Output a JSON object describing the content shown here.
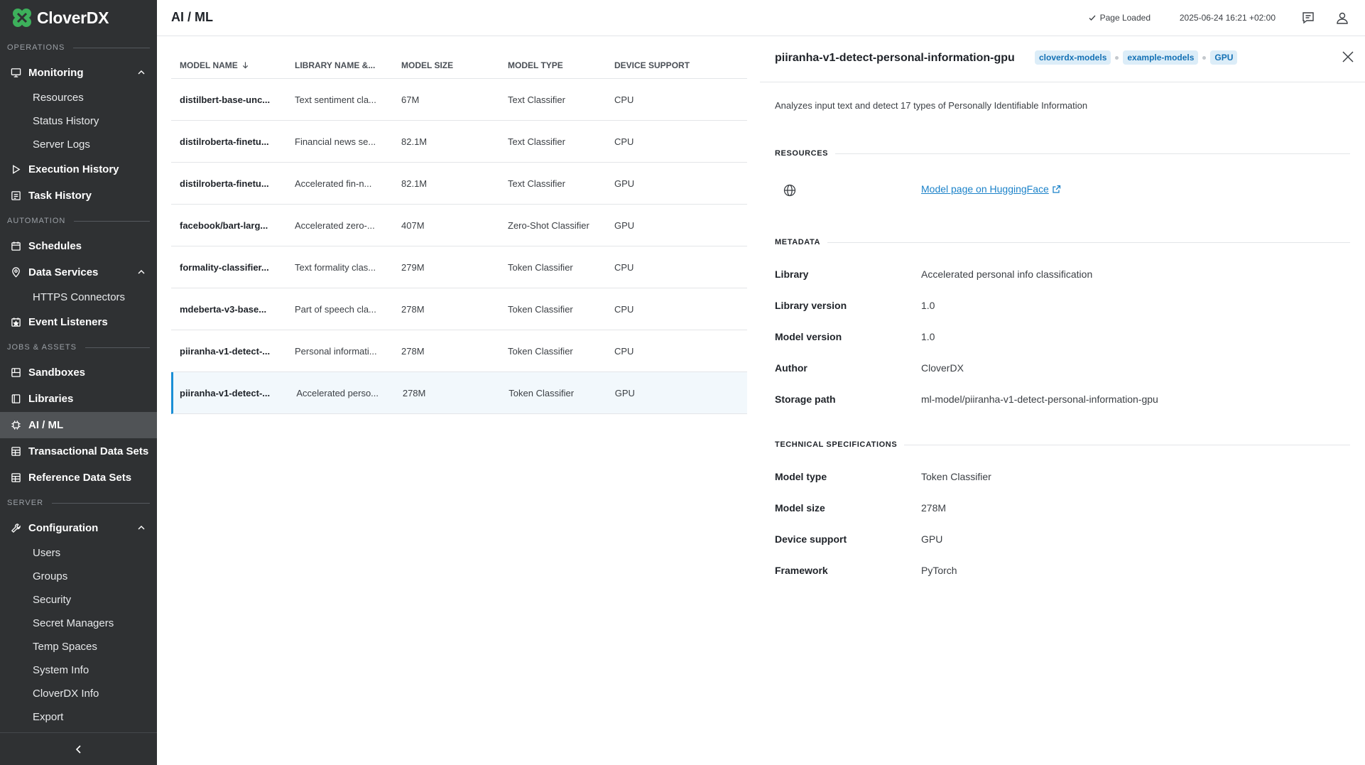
{
  "app": {
    "name": "CloverDX"
  },
  "sidebar": {
    "sections": {
      "operations": "OPERATIONS",
      "automation": "AUTOMATION",
      "jobs_assets": "JOBS & ASSETS",
      "server": "SERVER"
    },
    "monitoring": {
      "label": "Monitoring",
      "sub": [
        "Resources",
        "Status History",
        "Server Logs"
      ]
    },
    "execution_history": "Execution History",
    "task_history": "Task History",
    "schedules": "Schedules",
    "data_services": {
      "label": "Data Services",
      "sub": [
        "HTTPS Connectors"
      ]
    },
    "event_listeners": "Event Listeners",
    "sandboxes": "Sandboxes",
    "libraries": "Libraries",
    "ai_ml": "AI / ML",
    "transactional_data_sets": "Transactional Data Sets",
    "reference_data_sets": "Reference Data Sets",
    "configuration": {
      "label": "Configuration",
      "sub": [
        "Users",
        "Groups",
        "Security",
        "Secret Managers",
        "Temp Spaces",
        "System Info",
        "CloverDX Info",
        "Export"
      ]
    }
  },
  "header": {
    "title": "AI / ML",
    "status": "Page Loaded",
    "timestamp": "2025-06-24 16:21 +02:00"
  },
  "table": {
    "columns": [
      "MODEL NAME",
      "LIBRARY NAME &...",
      "MODEL SIZE",
      "MODEL TYPE",
      "DEVICE SUPPORT"
    ],
    "rows": [
      {
        "name": "distilbert-base-unc...",
        "library": "Text sentiment cla...",
        "size": "67M",
        "type": "Text Classifier",
        "device": "CPU"
      },
      {
        "name": "distilroberta-finetu...",
        "library": "Financial news se...",
        "size": "82.1M",
        "type": "Text Classifier",
        "device": "CPU"
      },
      {
        "name": "distilroberta-finetu...",
        "library": "Accelerated fin-n...",
        "size": "82.1M",
        "type": "Text Classifier",
        "device": "GPU"
      },
      {
        "name": "facebook/bart-larg...",
        "library": "Accelerated zero-...",
        "size": "407M",
        "type": "Zero-Shot Classifier",
        "device": "GPU"
      },
      {
        "name": "formality-classifier...",
        "library": "Text formality clas...",
        "size": "279M",
        "type": "Token Classifier",
        "device": "CPU"
      },
      {
        "name": "mdeberta-v3-base...",
        "library": "Part of speech cla...",
        "size": "278M",
        "type": "Token Classifier",
        "device": "CPU"
      },
      {
        "name": "piiranha-v1-detect-...",
        "library": "Personal informati...",
        "size": "278M",
        "type": "Token Classifier",
        "device": "CPU"
      },
      {
        "name": "piiranha-v1-detect-...",
        "library": "Accelerated perso...",
        "size": "278M",
        "type": "Token Classifier",
        "device": "GPU"
      }
    ]
  },
  "detail": {
    "title": "piiranha-v1-detect-personal-information-gpu",
    "tags": [
      "cloverdx-models",
      "example-models",
      "GPU"
    ],
    "description": "Analyzes input text and detect 17 types of Personally Identifiable Information",
    "resources_label": "RESOURCES",
    "resource_link": "Model page on HuggingFace",
    "metadata_label": "METADATA",
    "metadata": [
      {
        "k": "Library",
        "v": "Accelerated personal info classification"
      },
      {
        "k": "Library version",
        "v": "1.0"
      },
      {
        "k": "Model version",
        "v": "1.0"
      },
      {
        "k": "Author",
        "v": "CloverDX"
      },
      {
        "k": "Storage path",
        "v": "ml-model/piiranha-v1-detect-personal-information-gpu"
      }
    ],
    "tech_label": "TECHNICAL SPECIFICATIONS",
    "tech": [
      {
        "k": "Model type",
        "v": "Token Classifier"
      },
      {
        "k": "Model size",
        "v": "278M"
      },
      {
        "k": "Device support",
        "v": "GPU"
      },
      {
        "k": "Framework",
        "v": "PyTorch"
      }
    ]
  }
}
